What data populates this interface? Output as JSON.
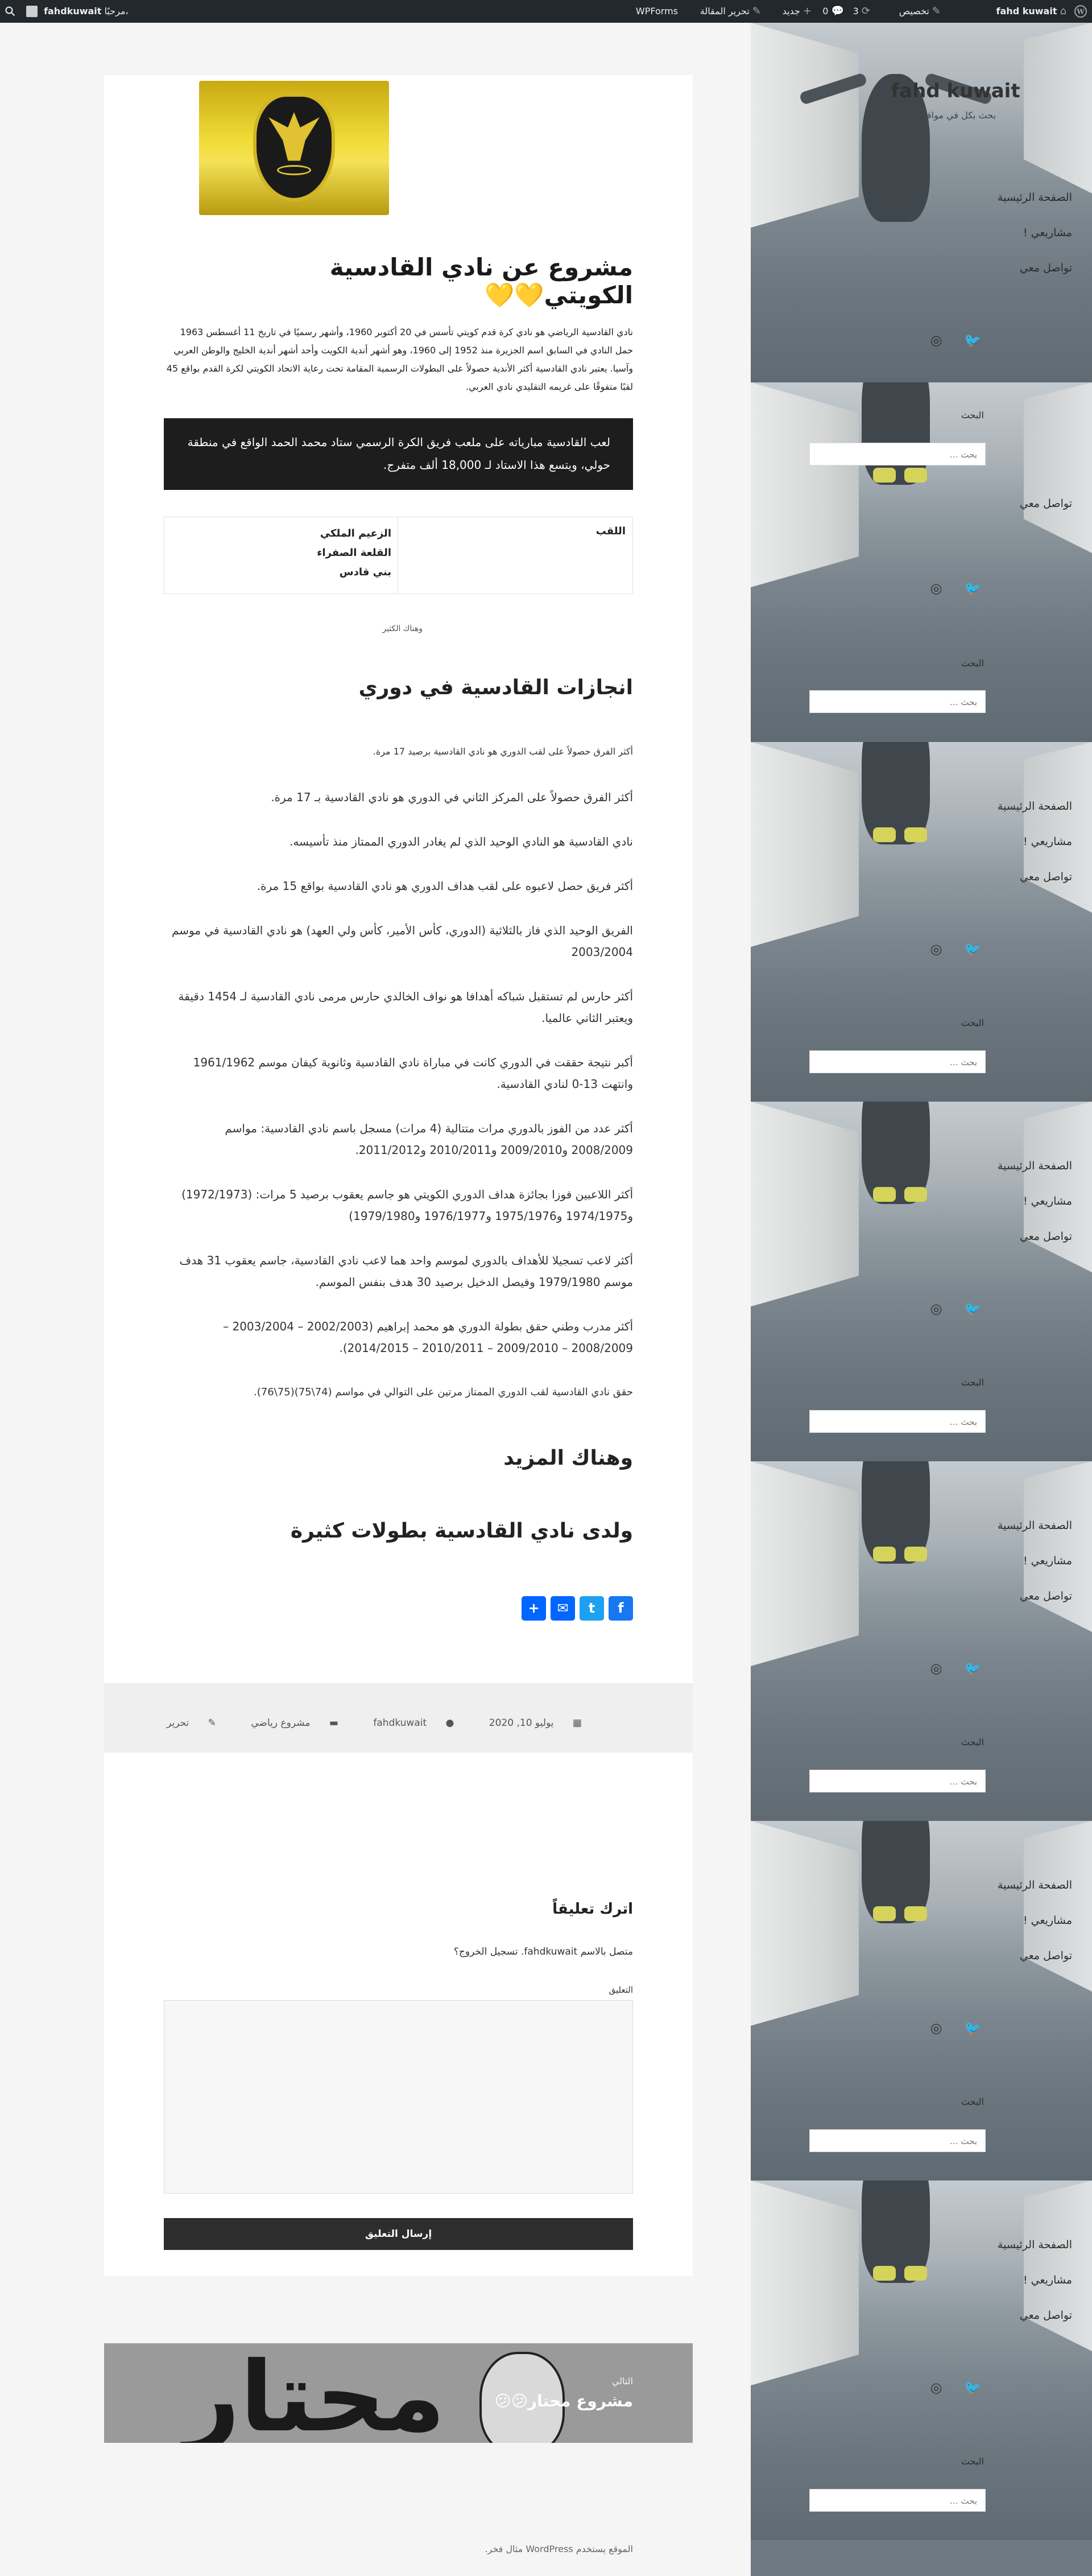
{
  "admin_bar": {
    "site_name": "fahd kuwait",
    "customize": "تخصيص",
    "updates_count": "3",
    "comments_count": "0",
    "new": "جديد",
    "edit_article": "تحرير المقالة",
    "wpforms": "WPForms",
    "greeting": "مرحبًا،",
    "username": "fahdkuwait"
  },
  "sidebar": {
    "site_title": "fahd kuwait",
    "tagline": "بحث بكل في مواقعي",
    "nav": [
      "الصفحة الرئيسية",
      "مشاريعي !",
      "تواصل معي"
    ],
    "search_title": "البحث",
    "search_placeholder": "بحث …"
  },
  "article": {
    "title": "مشروع عن نادي القادسية الكويتي💛💛",
    "intro": "نادي القادسية الرياضي هو نادي كرة قدم كويتي تأسس في 20 أكتوبر 1960، وأشهر رسميًا في تاريخ 11 أغسطس 1963 حمل النادي في السابق اسم الجزيرة منذ 1952 إلى 1960، وهو أشهر أندية الكويت وأحد أشهر أندية الخليج والوطن العربي وآسيا. يعتبر نادي القادسية أكثر الأندية حصولاً على البطولات الرسمية المقامة تحت رعاية الاتحاد الكويتي لكرة القدم بواقع 45 لقبًا متفوقًا على غريمه التقليدي نادي العربي.",
    "quote": "لعب القادسية مبارياته على ملعب فريق الكرة الرسمي ستاد محمد الحمد الواقع في منطقة حولي، ويتسع هذا الاستاد لـ 18,000 ألف متفرج.",
    "table": {
      "key": "اللقب",
      "values": [
        "الزعيم الملكي",
        "القلعة الصفراء",
        "بني قادس"
      ]
    },
    "more_small": "وهناك الكثير",
    "achievements_heading": "انجازات القادسية في دوري",
    "achievements": [
      "أكثر الفرق حصولاً على لقب الدوري هو نادي القادسية برصيد 17 مرة.",
      "أكثر الفرق حصولاً على المركز الثاني في الدوري هو نادي القادسية بـ 17 مرة.",
      "نادي القادسية هو النادي الوحيد الذي لم يغادر الدوري الممتاز منذ تأسيسه.",
      "أكثر فريق حصل لاعبوه على لقب هداف الدوري هو نادي القادسية بواقع 15 مرة.",
      "الفريق الوحيد الذي فاز بالثلاثية (الدوري، كأس الأمير، كأس ولي العهد) هو نادي القادسية في موسم 2003/2004",
      "أكثر حارس لم تستقبل شباكه أهدافا هو نواف الخالدي حارس مرمى نادي القادسية لـ 1454 دقيقة ويعتبر الثاني عالميا.",
      "أكبر نتيجة حققت في الدوري كانت في مباراة نادي القادسية وثانوية كيفان موسم 1961/1962 وانتهت 13-0 لنادي القادسية.",
      "أكثر عدد من الفوز بالدوري مرات متتالية (4 مرات) مسجل باسم نادي القادسية: مواسم 2008/2009 و2009/2010 و2010/2011 و2011/2012.",
      "أكثر اللاعبين فوزا بجائزة هداف الدوري الكويتي هو جاسم يعقوب برصيد 5 مرات: (1972/1973) و1974/1975 و1975/1976 و1976/1977 و1979/1980)",
      "أكثر لاعب تسجيلا للأهداف بالدوري لموسم واحد هما لاعب نادي القادسية، جاسم يعقوب 31 هدف موسم 1979/1980 وفيصل الدخيل برصيد 30 هدف بنفس الموسم.",
      "أكثر مدرب وطني حقق بطولة الدوري هو محمد إبراهيم (2002/2003 – 2003/2004 – 2008/2009 – 2009/2010 – 2010/2011 – 2014/2015).",
      "حقق نادي القادسية لقب الدوري الممتاز مرتين على التوالي في مواسم (74\\75)(75\\76)."
    ],
    "more_heading": "وهناك المزيد",
    "championships_heading": "ولدى نادي القادسية بطولات كثيرة"
  },
  "share": {
    "facebook": "f",
    "twitter": "t",
    "email": "✉",
    "more": "+"
  },
  "meta": {
    "date": "يوليو 10, 2020",
    "author": "fahdkuwait",
    "category": "مشروع رياضي",
    "edit": "تحرير"
  },
  "comment_form": {
    "title": "اترك تعليقاً",
    "logged_in": "متصل بالاسم fahdkuwait. تسجيل الخروج؟",
    "label": "التعليق",
    "submit": "إرسال التعليق"
  },
  "next_post": {
    "label": "التالي",
    "title": "مشروع محتار😕😕",
    "art_text": "محتار"
  },
  "footer": {
    "text": "الموقع يستخدم WordPress مثال فخر."
  },
  "colors": {
    "admin_bar": "#23282d",
    "quote_bg": "#1d1d1d",
    "facebook": "#1877f2",
    "twitter": "#1da1f2",
    "email": "#0166ff",
    "more": "#0166ff"
  }
}
